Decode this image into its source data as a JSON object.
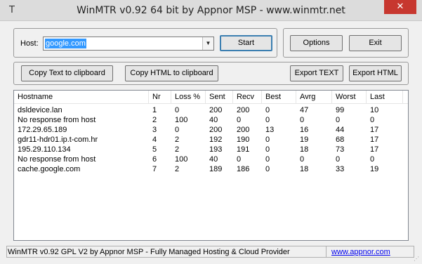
{
  "window": {
    "title": "WinMTR v0.92 64 bit by Appnor MSP - www.winmtr.net",
    "app_icon": "T",
    "close_glyph": "✕"
  },
  "host": {
    "label": "Host:",
    "value": "google.com"
  },
  "buttons": {
    "start": "Start",
    "options": "Options",
    "exit": "Exit",
    "copy_text": "Copy Text to clipboard",
    "copy_html": "Copy HTML to clipboard",
    "export_text": "Export TEXT",
    "export_html": "Export HTML"
  },
  "table": {
    "columns": [
      "Hostname",
      "Nr",
      "Loss %",
      "Sent",
      "Recv",
      "Best",
      "Avrg",
      "Worst",
      "Last"
    ],
    "rows": [
      [
        "dsldevice.lan",
        "1",
        "0",
        "200",
        "200",
        "0",
        "47",
        "99",
        "10"
      ],
      [
        "No response from host",
        "2",
        "100",
        "40",
        "0",
        "0",
        "0",
        "0",
        "0"
      ],
      [
        "172.29.65.189",
        "3",
        "0",
        "200",
        "200",
        "13",
        "16",
        "44",
        "17"
      ],
      [
        "gdr11-hdr01.ip.t-com.hr",
        "4",
        "2",
        "192",
        "190",
        "0",
        "19",
        "68",
        "17"
      ],
      [
        "195.29.110.134",
        "5",
        "2",
        "193",
        "191",
        "0",
        "18",
        "73",
        "17"
      ],
      [
        "No response from host",
        "6",
        "100",
        "40",
        "0",
        "0",
        "0",
        "0",
        "0"
      ],
      [
        "cache.google.com",
        "7",
        "2",
        "189",
        "186",
        "0",
        "18",
        "33",
        "19"
      ]
    ]
  },
  "status": {
    "text": "WinMTR v0.92 GPL V2 by Appnor MSP - Fully Managed Hosting & Cloud Provider",
    "link": "www.appnor.com"
  },
  "colors": {
    "close_button": "#c7372f",
    "selection": "#3399ff",
    "link": "#0000ee"
  }
}
